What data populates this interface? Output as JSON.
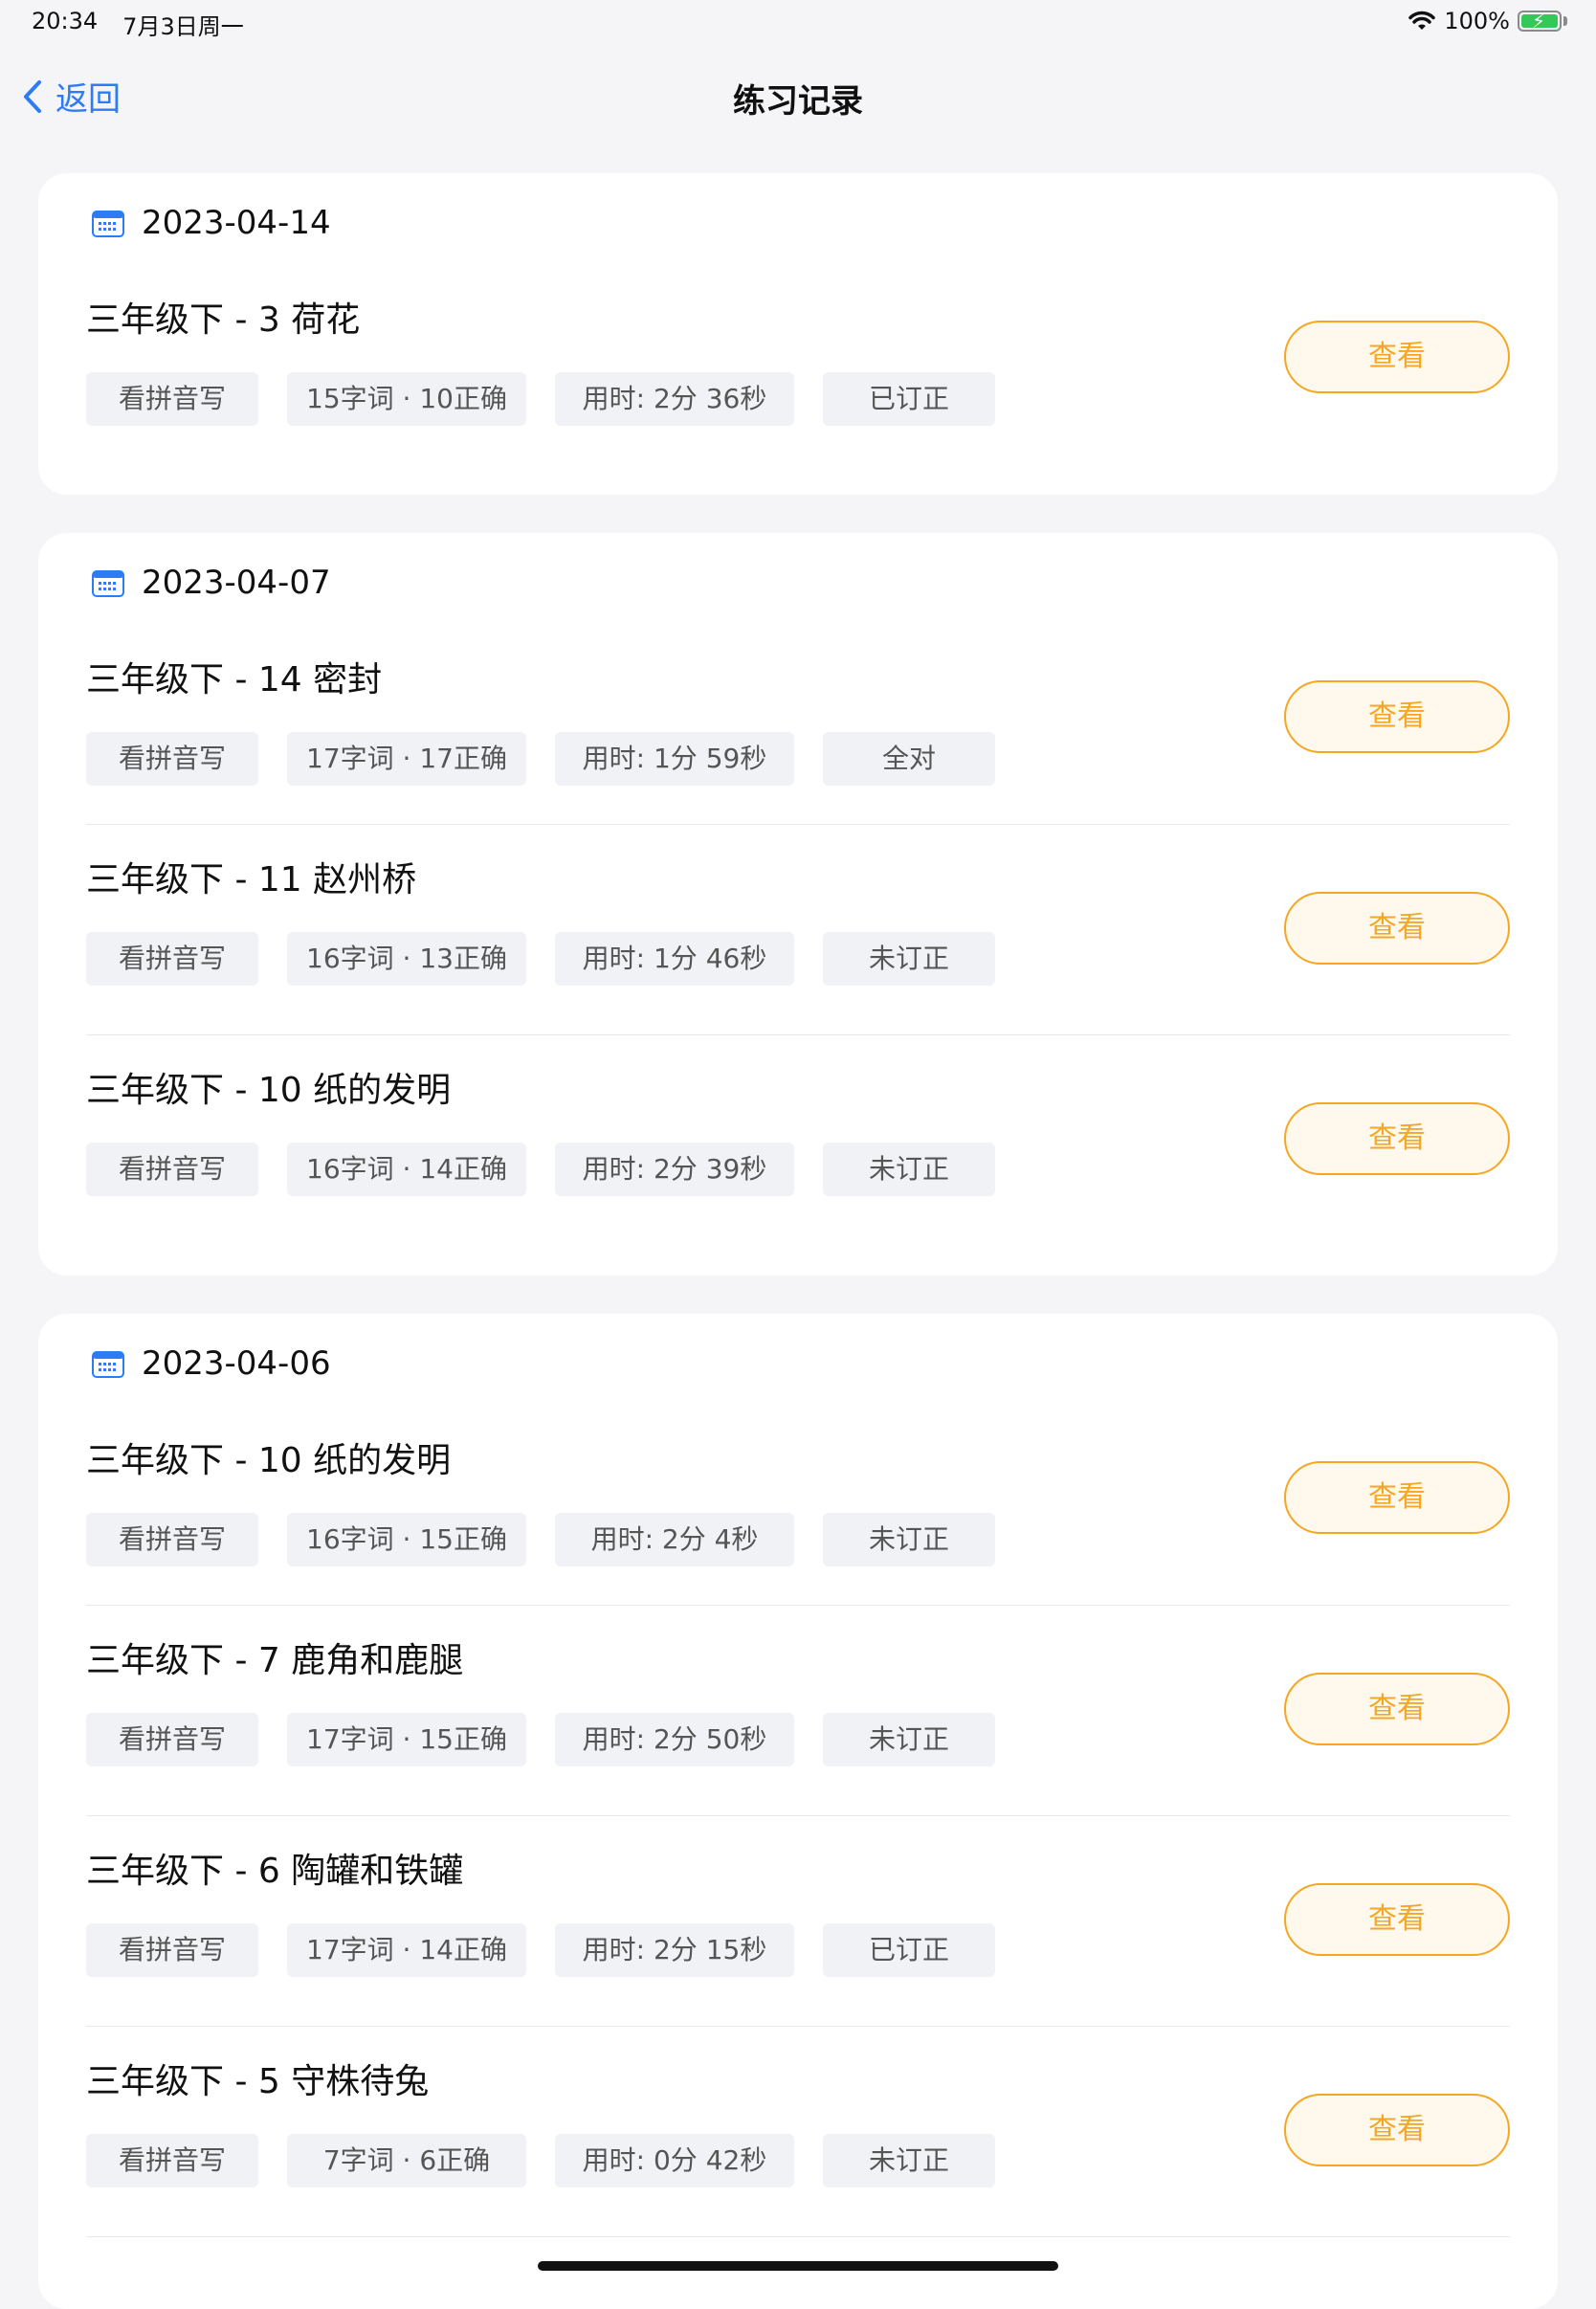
{
  "status_bar": {
    "time": "20:34",
    "date": "7月3日周一",
    "battery": "100%",
    "battery_level": 1.0
  },
  "nav": {
    "back_label": "返回",
    "title": "练习记录"
  },
  "groups": [
    {
      "date": "2023-04-14",
      "items": [
        {
          "title": "三年级下 - 3 荷花",
          "type": "看拼音写",
          "count": "15字词 · 10正确",
          "time": "用时: 2分 36秒",
          "status": "已订正",
          "action": "查看"
        }
      ]
    },
    {
      "date": "2023-04-07",
      "items": [
        {
          "title": "三年级下 - 14 密封",
          "type": "看拼音写",
          "count": "17字词 · 17正确",
          "time": "用时: 1分 59秒",
          "status": "全对",
          "action": "查看"
        },
        {
          "title": "三年级下 - 11 赵州桥",
          "type": "看拼音写",
          "count": "16字词 · 13正确",
          "time": "用时: 1分 46秒",
          "status": "未订正",
          "action": "查看"
        },
        {
          "title": "三年级下 - 10 纸的发明",
          "type": "看拼音写",
          "count": "16字词 · 14正确",
          "time": "用时: 2分 39秒",
          "status": "未订正",
          "action": "查看"
        }
      ]
    },
    {
      "date": "2023-04-06",
      "items": [
        {
          "title": "三年级下 - 10 纸的发明",
          "type": "看拼音写",
          "count": "16字词 · 15正确",
          "time": "用时: 2分 4秒",
          "status": "未订正",
          "action": "查看"
        },
        {
          "title": "三年级下 - 7 鹿角和鹿腿",
          "type": "看拼音写",
          "count": "17字词 · 15正确",
          "time": "用时: 2分 50秒",
          "status": "未订正",
          "action": "查看"
        },
        {
          "title": "三年级下 - 6 陶罐和铁罐",
          "type": "看拼音写",
          "count": "17字词 · 14正确",
          "time": "用时: 2分 15秒",
          "status": "已订正",
          "action": "查看"
        },
        {
          "title": "三年级下 - 5 守株待兔",
          "type": "看拼音写",
          "count": "7字词 · 6正确",
          "time": "用时: 0分 42秒",
          "status": "未订正",
          "action": "查看"
        }
      ]
    }
  ],
  "colors": {
    "accent_orange": "#f5a623",
    "link_blue": "#2d7cf6",
    "background": "#f5f5f7",
    "chip_bg": "#f1f2f5"
  },
  "icons": {
    "back": "chevron-left-icon",
    "date": "calendar-icon",
    "wifi": "wifi-icon",
    "battery": "battery-charging-icon"
  }
}
